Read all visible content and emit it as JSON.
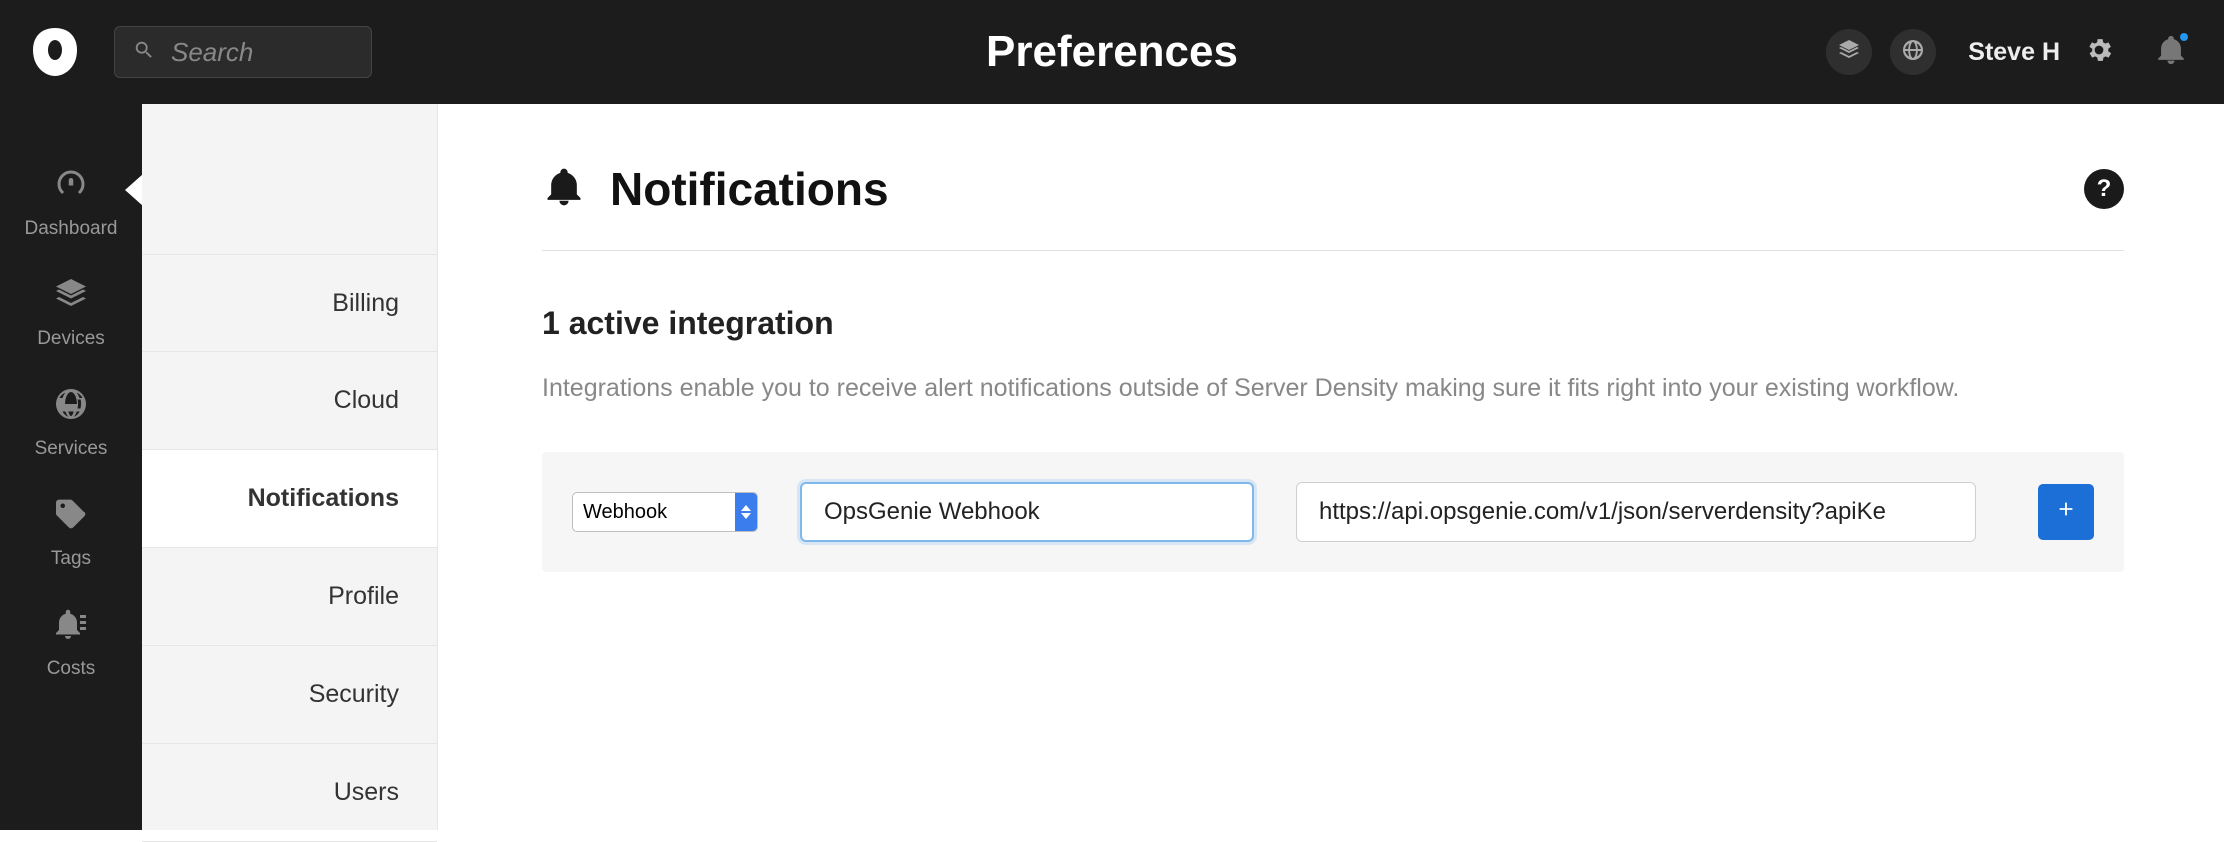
{
  "topbar": {
    "title": "Preferences",
    "search_placeholder": "Search",
    "user_name": "Steve H"
  },
  "nav": {
    "items": [
      {
        "id": "dashboard",
        "label": "Dashboard",
        "icon": "gauge",
        "active": true
      },
      {
        "id": "devices",
        "label": "Devices",
        "icon": "stack"
      },
      {
        "id": "services",
        "label": "Services",
        "icon": "globe"
      },
      {
        "id": "tags",
        "label": "Tags",
        "icon": "tag"
      },
      {
        "id": "costs",
        "label": "Costs",
        "icon": "bell-lines"
      }
    ]
  },
  "secondary": {
    "items": [
      {
        "id": "billing",
        "label": "Billing"
      },
      {
        "id": "cloud",
        "label": "Cloud"
      },
      {
        "id": "notifications",
        "label": "Notifications",
        "active": true
      },
      {
        "id": "profile",
        "label": "Profile"
      },
      {
        "id": "security",
        "label": "Security"
      },
      {
        "id": "users",
        "label": "Users"
      }
    ]
  },
  "main": {
    "page_title": "Notifications",
    "section_title": "1 active integration",
    "section_desc": "Integrations enable you to receive alert notifications outside of Server Density making sure it fits right into your existing workflow.",
    "help_label": "?",
    "integration_row": {
      "type_options": [
        "Webhook"
      ],
      "type_selected": "Webhook",
      "name_value": "OpsGenie Webhook",
      "url_value": "https://api.opsgenie.com/v1/json/serverdensity?apiKe"
    }
  }
}
